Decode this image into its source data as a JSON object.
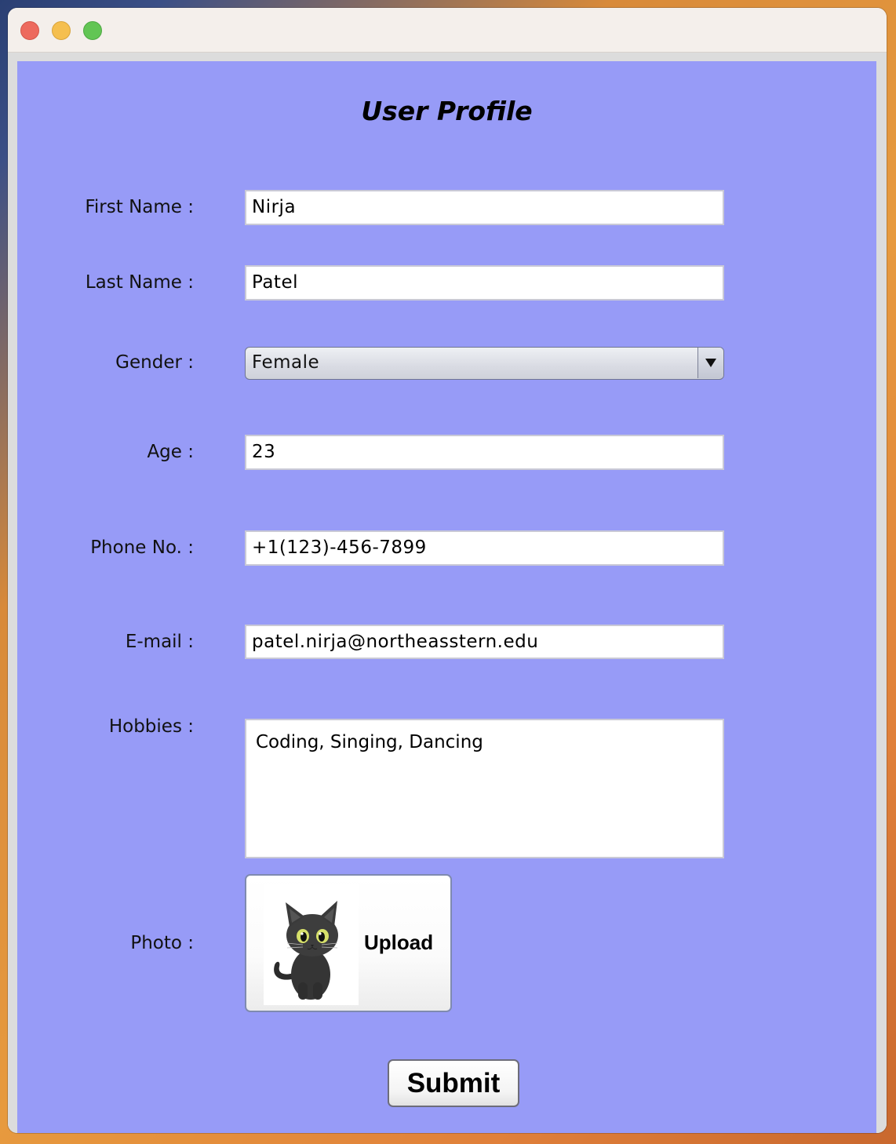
{
  "window": {
    "controls": [
      "close-button",
      "minimize-button",
      "maximize-button"
    ]
  },
  "form": {
    "title": "User Profile",
    "first_name": {
      "label": "First Name :",
      "value": "Nirja"
    },
    "last_name": {
      "label": "Last Name :",
      "value": "Patel"
    },
    "gender": {
      "label": "Gender :",
      "value": "Female"
    },
    "age": {
      "label": "Age :",
      "value": "23"
    },
    "phone": {
      "label": "Phone No. :",
      "value": "+1(123)-456-7899"
    },
    "email": {
      "label": "E-mail :",
      "value": "patel.nirja@northeasstern.edu"
    },
    "hobbies": {
      "label": "Hobbies :",
      "value": "Coding, Singing, Dancing"
    },
    "photo": {
      "label": "Photo :",
      "upload_label": "Upload",
      "thumbnail_icon": "black-cat-icon"
    },
    "submit_label": "Submit"
  },
  "colors": {
    "panel_background": "#979bf7",
    "close": "#ed6a5e",
    "minimize": "#f5bf4f",
    "maximize": "#62c554"
  }
}
